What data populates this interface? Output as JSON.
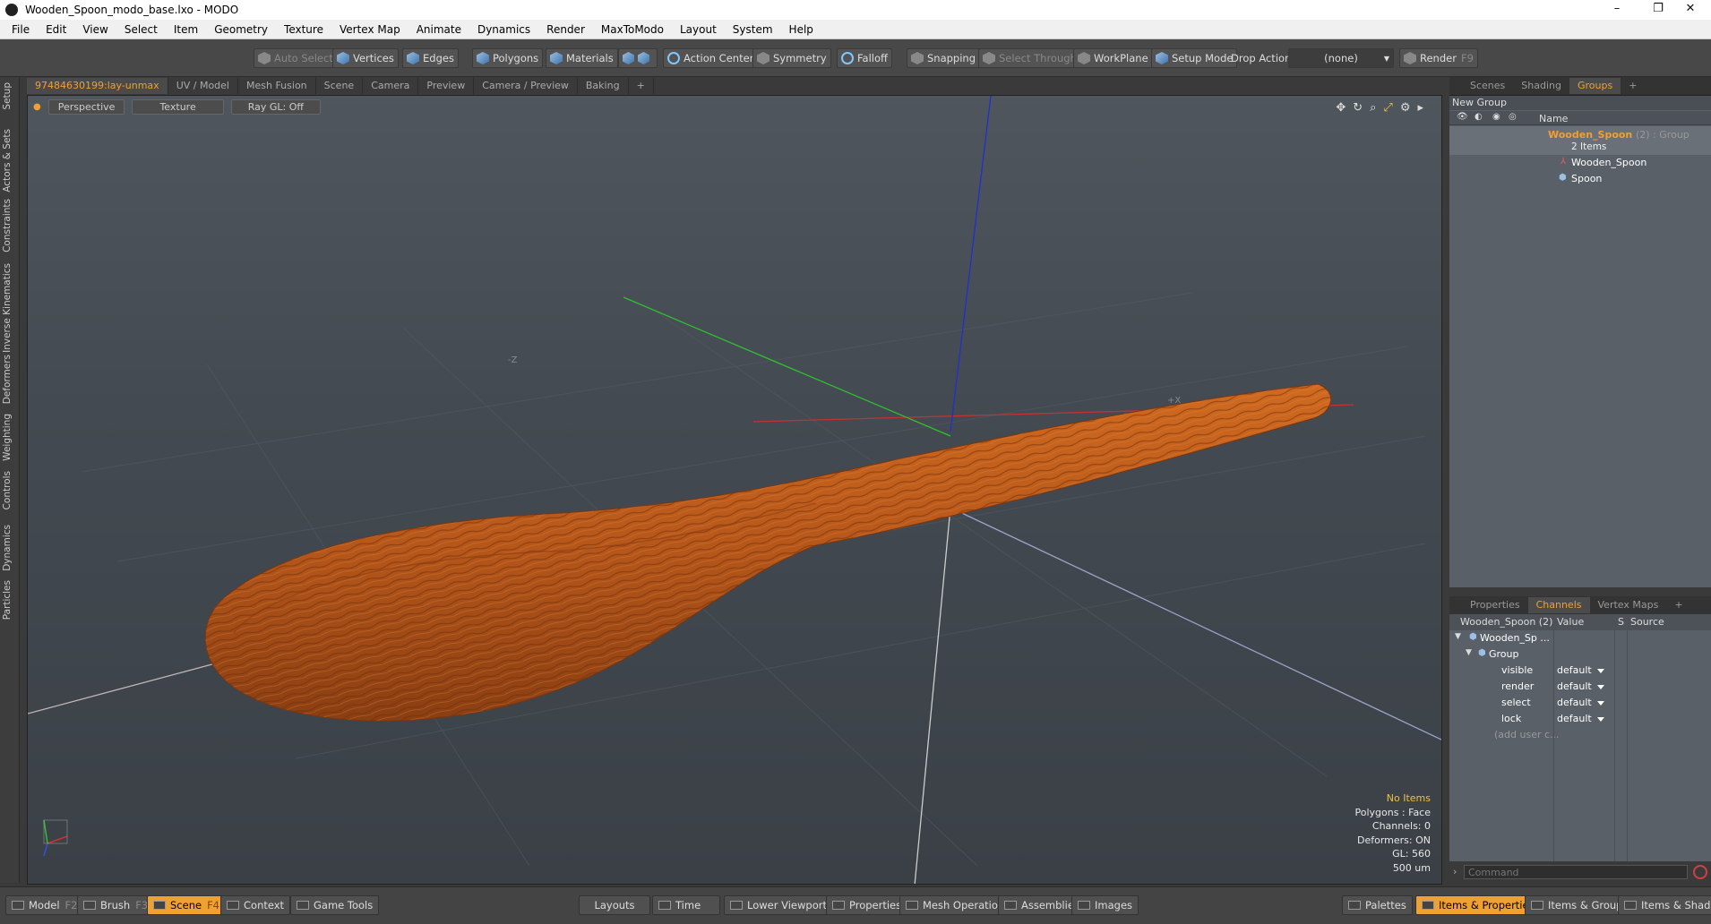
{
  "window": {
    "title": "Wooden_Spoon_modo_base.lxo - MODO",
    "minimize": "–",
    "maximize": "❐",
    "close": "✕"
  },
  "menu": [
    "File",
    "Edit",
    "View",
    "Select",
    "Item",
    "Geometry",
    "Texture",
    "Vertex Map",
    "Animate",
    "Dynamics",
    "Render",
    "MaxToModo",
    "Layout",
    "System",
    "Help"
  ],
  "toolbar": {
    "auto_select": "Auto Select",
    "vertices": "Vertices",
    "edges": "Edges",
    "polygons": "Polygons",
    "materials": "Materials",
    "action_center": "Action Center",
    "symmetry": "Symmetry",
    "falloff": "Falloff",
    "snapping": "Snapping",
    "select_through": "Select Through",
    "workplane": "WorkPlane",
    "setup_mode": "Setup Mode",
    "drop_action": "Drop Action",
    "drop_value": "(none)",
    "render": "Render",
    "render_key": "F9"
  },
  "left_tabs": [
    "Setup",
    "Actors & Sets",
    "Constraints",
    "Inverse Kinematics",
    "Deformers",
    "Weighting",
    "Controls",
    "Dynamics",
    "Particles"
  ],
  "viewport_tabs": [
    "97484630199:lay-unmax",
    "UV / Model",
    "Mesh Fusion",
    "Scene",
    "Camera",
    "Preview",
    "Camera / Preview",
    "Baking",
    "+"
  ],
  "viewport": {
    "view": "Perspective",
    "shading": "Texture",
    "raygl": "Ray GL: Off",
    "axis_neg_z": "-Z",
    "axis_pos_x": "+X",
    "info": {
      "items": "No Items",
      "polygons": "Polygons : Face",
      "channels": "Channels: 0",
      "deformers": "Deformers: ON",
      "gl": "GL: 560",
      "scale": "500 um"
    }
  },
  "groups_panel": {
    "tabs": [
      "Scenes",
      "Shading",
      "Groups",
      "+"
    ],
    "new_group": "New Group",
    "name_header": "Name",
    "group_name": "Wooden_Spoon",
    "group_suffix": "(2) : Group",
    "group_count": "2 Items",
    "children": [
      "Wooden_Spoon",
      "Spoon"
    ]
  },
  "channels_panel": {
    "tabs": [
      "Properties",
      "Channels",
      "Vertex Maps",
      "+"
    ],
    "headers": {
      "item": "Wooden_Spoon (2)",
      "value": "Value",
      "s": "S",
      "source": "Source"
    },
    "root": "Wooden_Sp ...",
    "group": "Group",
    "rows": [
      {
        "name": "visible",
        "value": "default"
      },
      {
        "name": "render",
        "value": "default"
      },
      {
        "name": "select",
        "value": "default"
      },
      {
        "name": "lock",
        "value": "default"
      }
    ],
    "add_user": "(add user c...",
    "command_placeholder": "Command"
  },
  "bottom": {
    "model": "Model",
    "model_key": "F2",
    "brush": "Brush",
    "brush_key": "F3",
    "scene": "Scene",
    "scene_key": "F4",
    "context": "Context",
    "game_tools": "Game Tools",
    "layouts": "Layouts",
    "time": "Time",
    "lower_viewports": "Lower Viewports",
    "properties": "Properties",
    "mesh_operations": "Mesh Operations",
    "assemblies": "Assemblies",
    "images": "Images",
    "palettes": "Palettes",
    "items_properties": "Items & Properties",
    "items_groups": "Items & Groups",
    "items_shading": "Items & Shading"
  },
  "colors": {
    "accent": "#f0a030",
    "axis_x": "#d03030",
    "axis_y": "#30c030",
    "axis_z": "#2030d0",
    "wood": "#b8581a"
  }
}
